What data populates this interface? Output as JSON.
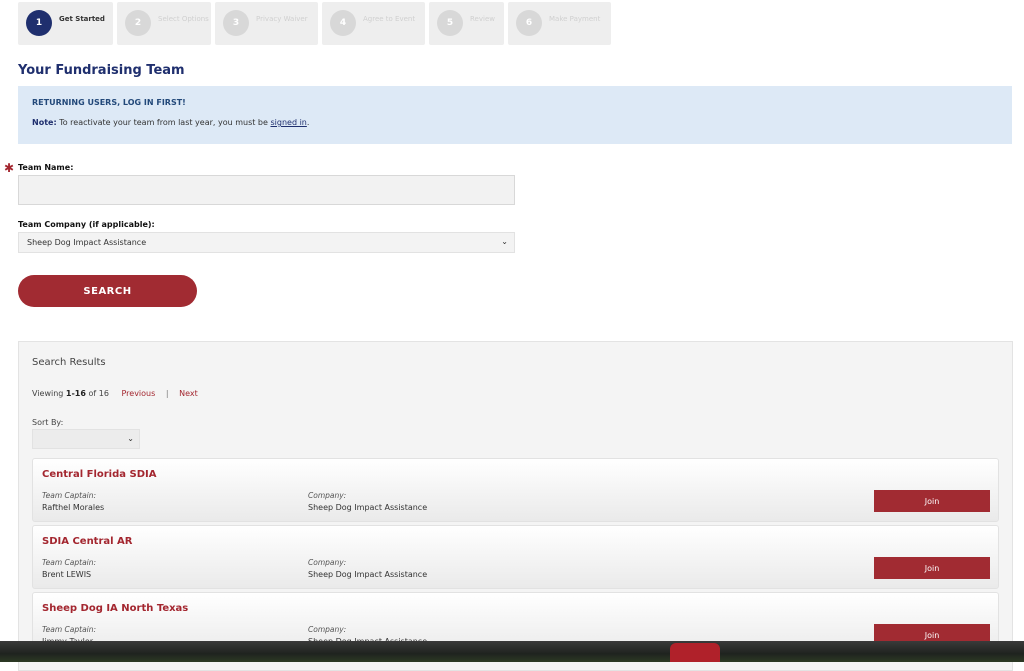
{
  "steps": [
    {
      "num": "1",
      "label": "Get Started",
      "active": true
    },
    {
      "num": "2",
      "label": "Select Options",
      "active": false
    },
    {
      "num": "3",
      "label": "Privacy Waiver",
      "active": false
    },
    {
      "num": "4",
      "label": "Agree to Event",
      "active": false
    },
    {
      "num": "5",
      "label": "Review",
      "active": false
    },
    {
      "num": "6",
      "label": "Make Payment",
      "active": false
    }
  ],
  "page": {
    "title": "Your Fundraising Team"
  },
  "notice": {
    "heading": "RETURNING USERS, LOG IN FIRST!",
    "note_label": "Note:",
    "note_text": "To reactivate your team from last year, you must be",
    "note_link": "signed in",
    "note_end": "."
  },
  "form": {
    "required_mark": "✱",
    "team_name_label": "Team Name:",
    "team_name_value": "",
    "company_label": "Team Company (if applicable):",
    "company_selected": "Sheep Dog Impact Assistance",
    "search_label": "SEARCH"
  },
  "results": {
    "title": "Search Results",
    "viewing_prefix": "Viewing",
    "viewing_range": "1-16",
    "viewing_suffix": "of 16",
    "previous": "Previous",
    "separator": "|",
    "next": "Next",
    "sort_label": "Sort By:",
    "sort_value": "",
    "captain_label": "Team Captain:",
    "company_label": "Company:",
    "join_label": "Join",
    "teams": [
      {
        "name": "Central Florida SDIA",
        "captain": "Rafthel Morales",
        "company": "Sheep Dog Impact Assistance"
      },
      {
        "name": "SDIA Central AR",
        "captain": "Brent LEWIS",
        "company": "Sheep Dog Impact Assistance"
      },
      {
        "name": "Sheep Dog IA North Texas",
        "captain": "Jimmy Taylor",
        "company": "Sheep Dog Impact Assistance"
      }
    ]
  },
  "icons": {
    "chevron": "chevron-down-icon"
  },
  "colors": {
    "navy": "#1f2f6e",
    "brand_red": "#a12b32",
    "notice_bg": "#dde9f6"
  }
}
